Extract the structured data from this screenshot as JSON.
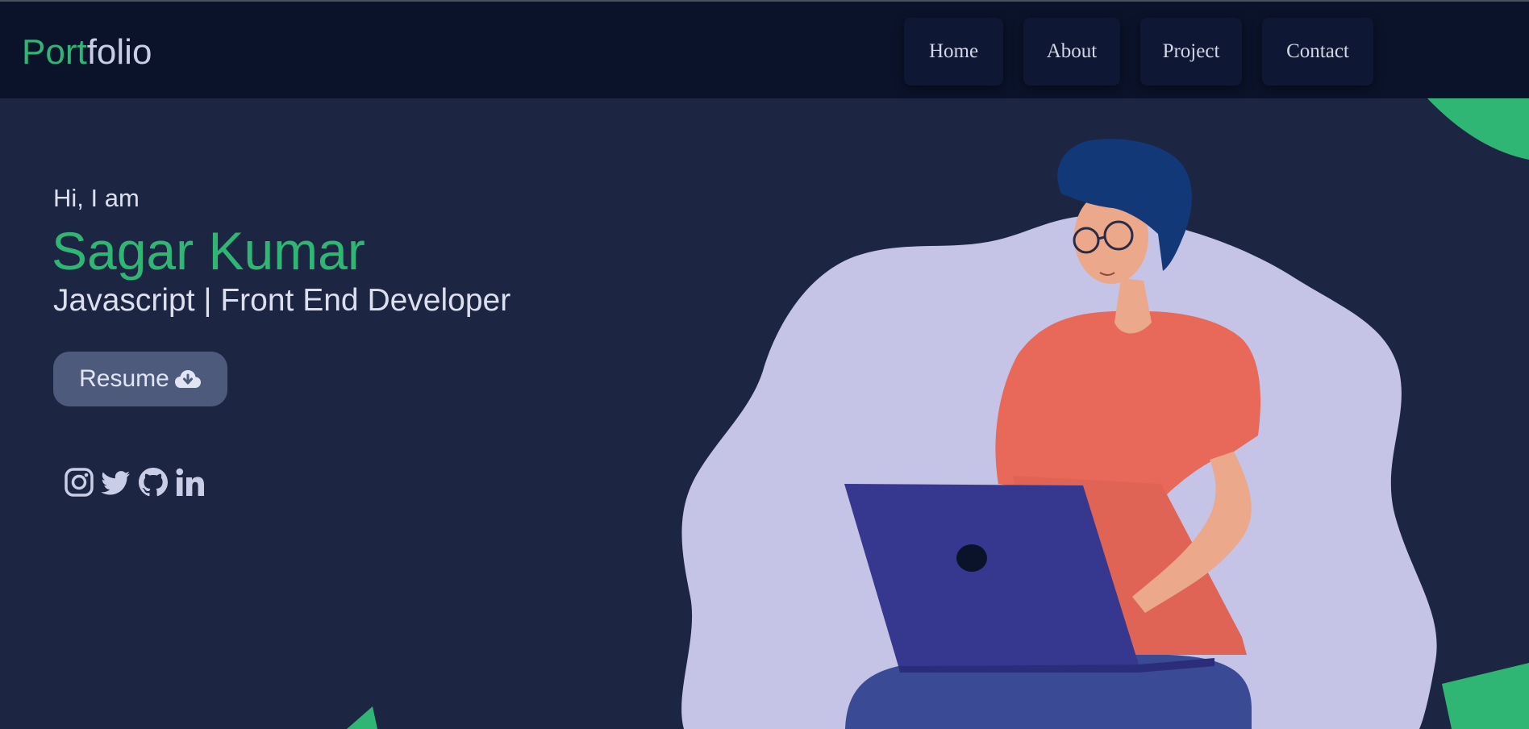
{
  "navbar": {
    "logo_primary": "Port",
    "logo_secondary": "folio",
    "links": [
      {
        "label": "Home"
      },
      {
        "label": "About"
      },
      {
        "label": "Project"
      },
      {
        "label": "Contact"
      }
    ]
  },
  "hero": {
    "greeting": "Hi, I am",
    "name": "Sagar Kumar",
    "role": "Javascript | Front End Developer",
    "resume_label": "Resume",
    "resume_icon": "cloud-download-icon"
  },
  "socials": [
    {
      "icon": "instagram-icon"
    },
    {
      "icon": "twitter-icon"
    },
    {
      "icon": "github-icon"
    },
    {
      "icon": "linkedin-icon"
    }
  ],
  "colors": {
    "background": "#1c2541",
    "navbar": "#0b132b",
    "accent_green": "#2fb574",
    "button": "#4d5a7c",
    "blob": "#c5c3e6",
    "shirt": "#e8685a",
    "laptop": "#36378f"
  }
}
